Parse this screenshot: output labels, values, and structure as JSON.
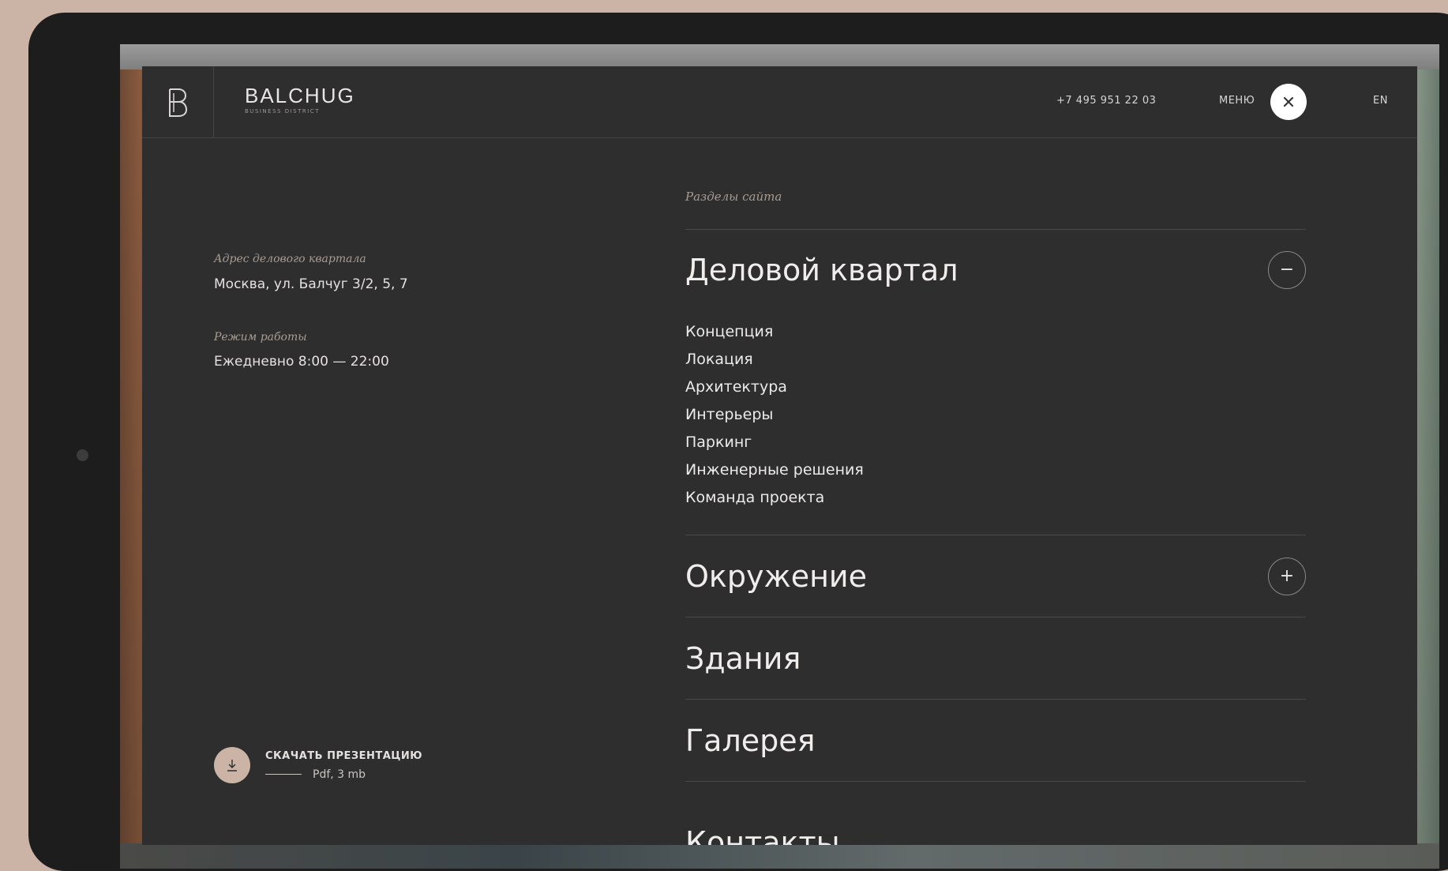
{
  "header": {
    "brand_name": "BALCHUG",
    "brand_sub": "BUSINESS DISTRICT",
    "phone": "+7 495 951 22 03",
    "menu_label": "МЕНЮ",
    "lang": "EN"
  },
  "info": {
    "address_label": "Адрес делового квартала",
    "address_value": "Москва, ул.  Балчуг 3/2, 5, 7",
    "hours_label": "Режим работы",
    "hours_value": "Ежедневно 8:00 — 22:00"
  },
  "download": {
    "title": "СКАЧАТЬ ПРЕЗЕНТАЦИЮ",
    "meta": "Pdf, 3 mb"
  },
  "nav": {
    "label": "Разделы сайта",
    "items": [
      {
        "title": "Деловой квартал",
        "toggle": "−",
        "sub": [
          "Концепция",
          "Локация",
          "Архитектура",
          "Интерьеры",
          "Паркинг",
          "Инженерные решения",
          "Команда проекта"
        ]
      },
      {
        "title": "Окружение",
        "toggle": "+"
      },
      {
        "title": "Здания"
      },
      {
        "title": "Галерея"
      },
      {
        "title": "Контакты"
      }
    ]
  },
  "colors": {
    "background": "#cbb3a6",
    "panel": "#2f2e2f",
    "accent": "#cbb3a6",
    "muted_label": "#a89c92"
  }
}
